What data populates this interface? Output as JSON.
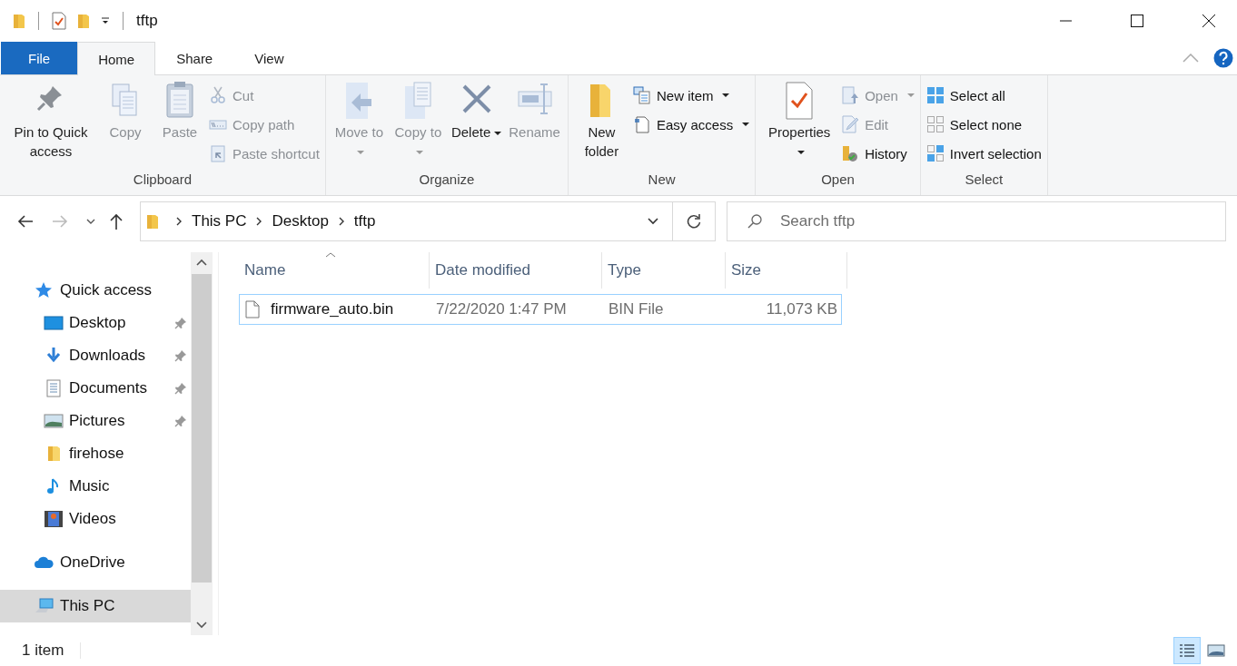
{
  "title_bar": {
    "title": "tftp"
  },
  "ribbon_tabs": [
    {
      "label": "File",
      "kind": "file",
      "selected": false
    },
    {
      "label": "Home",
      "kind": "tab",
      "selected": true
    },
    {
      "label": "Share",
      "kind": "tab",
      "selected": false
    },
    {
      "label": "View",
      "kind": "tab",
      "selected": false
    }
  ],
  "ribbon_groups": [
    {
      "label": "Clipboard",
      "commands": [
        {
          "label": "Pin to Quick access",
          "kind": "large",
          "disabled": false,
          "dropdown": false
        },
        {
          "label": "Copy",
          "kind": "large",
          "disabled": true,
          "dropdown": false
        },
        {
          "label": "Paste",
          "kind": "large",
          "disabled": true,
          "dropdown": false
        },
        {
          "label": "Cut",
          "kind": "small",
          "disabled": true,
          "dropdown": false
        },
        {
          "label": "Copy path",
          "kind": "small",
          "disabled": true,
          "dropdown": false
        },
        {
          "label": "Paste shortcut",
          "kind": "small",
          "disabled": true,
          "dropdown": false
        }
      ]
    },
    {
      "label": "Organize",
      "commands": [
        {
          "label": "Move to",
          "kind": "large",
          "disabled": true,
          "dropdown": true
        },
        {
          "label": "Copy to",
          "kind": "large",
          "disabled": true,
          "dropdown": true
        },
        {
          "label": "Delete",
          "kind": "large",
          "disabled": false,
          "dropdown": true
        },
        {
          "label": "Rename",
          "kind": "large",
          "disabled": true,
          "dropdown": false
        }
      ]
    },
    {
      "label": "New",
      "commands": [
        {
          "label": "New folder",
          "kind": "large",
          "disabled": false,
          "dropdown": false
        },
        {
          "label": "New item",
          "kind": "small",
          "disabled": false,
          "dropdown": true
        },
        {
          "label": "Easy access",
          "kind": "small",
          "disabled": false,
          "dropdown": true
        }
      ]
    },
    {
      "label": "Open",
      "commands": [
        {
          "label": "Properties",
          "kind": "large",
          "disabled": false,
          "dropdown": true
        },
        {
          "label": "Open",
          "kind": "small",
          "disabled": true,
          "dropdown": true
        },
        {
          "label": "Edit",
          "kind": "small",
          "disabled": true,
          "dropdown": false
        },
        {
          "label": "History",
          "kind": "small",
          "disabled": false,
          "dropdown": false
        }
      ]
    },
    {
      "label": "Select",
      "commands": [
        {
          "label": "Select all",
          "kind": "small",
          "disabled": false,
          "dropdown": false
        },
        {
          "label": "Select none",
          "kind": "small",
          "disabled": false,
          "dropdown": false
        },
        {
          "label": "Invert selection",
          "kind": "small",
          "disabled": false,
          "dropdown": false
        }
      ]
    }
  ],
  "address_bar": {
    "path": [
      "This PC",
      "Desktop",
      "tftp"
    ]
  },
  "search": {
    "placeholder": "Search tftp"
  },
  "sidebar": {
    "items": [
      {
        "label": "Quick access",
        "selected": false,
        "children": [
          {
            "label": "Desktop",
            "pinned": true,
            "selected": false
          },
          {
            "label": "Downloads",
            "pinned": true,
            "selected": false
          },
          {
            "label": "Documents",
            "pinned": true,
            "selected": false
          },
          {
            "label": "Pictures",
            "pinned": true,
            "selected": false
          },
          {
            "label": "firehose",
            "pinned": false,
            "selected": false
          },
          {
            "label": "Music",
            "pinned": false,
            "selected": false
          },
          {
            "label": "Videos",
            "pinned": false,
            "selected": false
          }
        ]
      },
      {
        "label": "OneDrive",
        "selected": false
      },
      {
        "label": "This PC",
        "selected": true
      }
    ]
  },
  "file_list": {
    "columns": [
      {
        "label": "Name",
        "sorted": true
      },
      {
        "label": "Date modified",
        "sorted": false
      },
      {
        "label": "Type",
        "sorted": false
      },
      {
        "label": "Size",
        "sorted": false
      }
    ],
    "rows": [
      {
        "name": "firmware_auto.bin",
        "date_modified": "7/22/2020 1:47 PM",
        "type": "BIN File",
        "size": "11,073 KB",
        "focused": true
      }
    ]
  },
  "status_bar": {
    "item_count": "1 item",
    "views": [
      {
        "kind": "details",
        "selected": true
      },
      {
        "kind": "large_icons",
        "selected": false
      }
    ]
  }
}
